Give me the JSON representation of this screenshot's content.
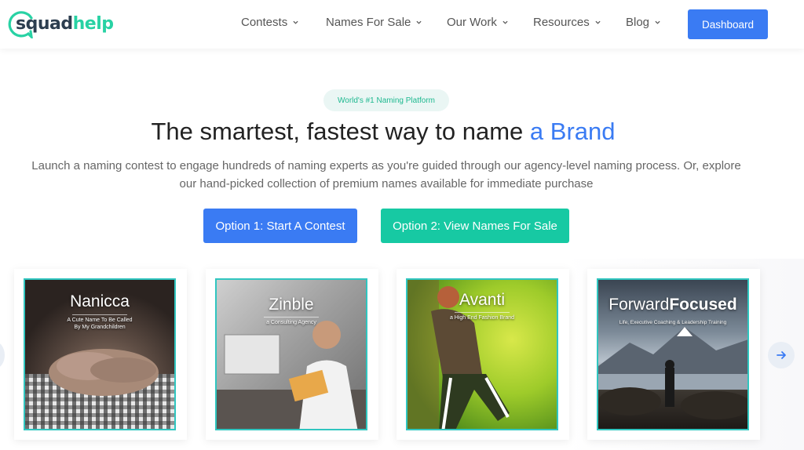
{
  "brand": {
    "part1": "squad",
    "part2": "help"
  },
  "nav": {
    "items": [
      {
        "label": "Contests"
      },
      {
        "label": "Names For Sale"
      },
      {
        "label": "Our Work"
      },
      {
        "label": "Resources"
      },
      {
        "label": "Blog"
      }
    ],
    "dashboard_label": "Dashboard"
  },
  "hero": {
    "badge": "World's #1 Naming Platform",
    "headline_main": "The smartest, fastest way to name",
    "headline_accent": "a Brand",
    "subtitle_line1": "Launch a naming contest to engage hundreds of naming experts as you're guided through our agency-level naming process. Or, explore",
    "subtitle_line2": "our hand-picked collection of premium names available for immediate purchase",
    "btn_contest": "Option 1: Start A Contest",
    "btn_names": "Option 2: View Names For Sale"
  },
  "cards": [
    {
      "title": "Nanicca",
      "subtitle_line1": "A Cute Name To Be Called",
      "subtitle_line2": "By My Grandchildren"
    },
    {
      "title": "Zinble",
      "subtitle_line1": "a Consulting Agency",
      "subtitle_line2": ""
    },
    {
      "title": "Avanti",
      "subtitle_line1": "a High End Fashion Brand",
      "subtitle_line2": ""
    },
    {
      "title_a": "Forward",
      "title_b": "Focused",
      "subtitle_line1": "Life, Executive Coaching & Leadership Training",
      "subtitle_line2": ""
    }
  ],
  "colors": {
    "primary": "#3a7bf3",
    "teal": "#17c9a3",
    "brand_dark": "#2d3e50",
    "brand_green": "#28d2a4"
  },
  "icons": {
    "nav_chevron": "chevron-down-icon",
    "carousel_next": "arrow-right-icon",
    "carousel_prev": "arrow-left-icon"
  }
}
